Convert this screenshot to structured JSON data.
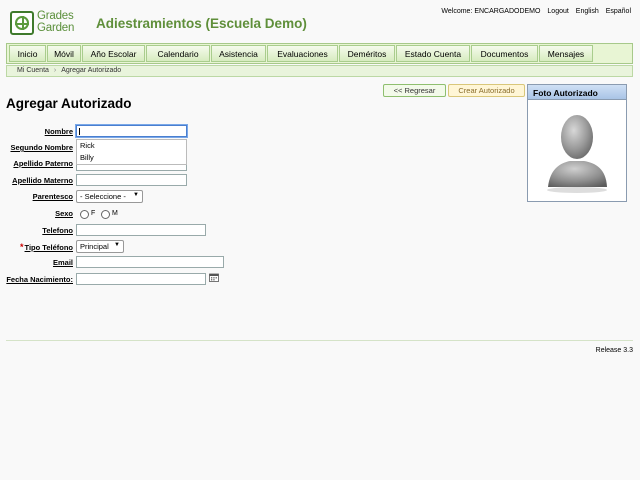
{
  "logo": {
    "line1": "Grades",
    "line2": "Garden"
  },
  "school_title": "Adiestramientos (Escuela Demo)",
  "toplinks": {
    "welcome": "Welcome: ENCARGADODEMO",
    "logout": "Logout",
    "english": "English",
    "spanish": "Español"
  },
  "nav": [
    "Inicio",
    "Móvil",
    "Año Escolar",
    "Calendario",
    "Asistencia",
    "Evaluaciones",
    "Deméritos",
    "Estado Cuenta",
    "Documentos",
    "Mensajes"
  ],
  "breadcrumb": {
    "root": "Mi Cuenta",
    "current": "Agregar Autorizado"
  },
  "page_title": "Agregar Autorizado",
  "buttons": {
    "back": "<< Regresar",
    "create": "Crear Autorizado"
  },
  "photo_panel": {
    "title": "Foto Autorizado"
  },
  "form": {
    "nombre": {
      "label": "Nombre",
      "value": ""
    },
    "segundo_nombre": {
      "label": "Segundo Nombre"
    },
    "apellido_paterno": {
      "label": "Apellido Paterno"
    },
    "apellido_materno": {
      "label": "Apellido Materno"
    },
    "parentesco": {
      "label": "Parentesco",
      "selected": "- Seleccione -"
    },
    "sexo": {
      "label": "Sexo",
      "option_f": "F",
      "option_m": "M"
    },
    "telefono": {
      "label": "Telefono"
    },
    "tipo_telefono": {
      "label": "Tipo Teléfono",
      "required_mark": "*",
      "selected": "Principal"
    },
    "email": {
      "label": "Email"
    },
    "fecha_nacimiento": {
      "label": "Fecha Nacimiento:"
    }
  },
  "autocomplete": [
    "Rick",
    "Billy"
  ],
  "release": "Release 3.3",
  "colors": {
    "brand_green": "#5f8f3a",
    "nav_bg": "#e8f5d4",
    "create_btn": "#fff6d6"
  }
}
